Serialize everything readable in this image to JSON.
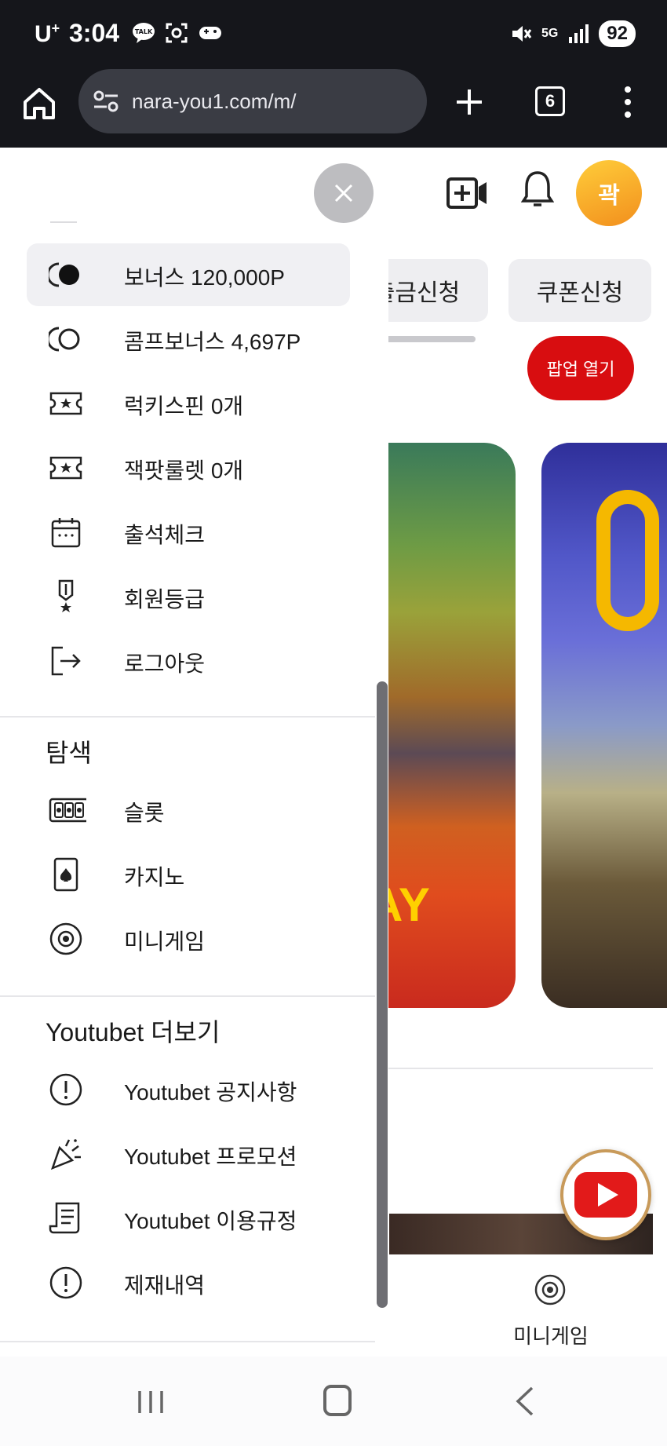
{
  "status_bar": {
    "carrier": "U",
    "carrier_sup": "+",
    "time": "3:04",
    "network": "5G",
    "battery": "92"
  },
  "browser": {
    "url": "nara-you1.com/m/",
    "tab_count": "6"
  },
  "background_page": {
    "avatar_text": "곽",
    "withdraw_label": "출금신청",
    "coupon_label": "쿠폰신청",
    "popup_button": "팝업 열기",
    "card_text": "AY",
    "bottom_nav_label": "미니게임"
  },
  "drawer": {
    "account_items": [
      {
        "label": "보너스 120,000P",
        "icon": "bonus-filled-icon",
        "active": true
      },
      {
        "label": "콤프보너스 4,697P",
        "icon": "comp-bonus-icon"
      },
      {
        "label": "럭키스핀 0개",
        "icon": "ticket-icon"
      },
      {
        "label": "잭팟룰렛 0개",
        "icon": "ticket-icon"
      },
      {
        "label": "출석체크",
        "icon": "calendar-icon"
      },
      {
        "label": "회원등급",
        "icon": "medal-icon"
      },
      {
        "label": "로그아웃",
        "icon": "logout-icon"
      }
    ],
    "explore_title": "탐색",
    "explore_items": [
      {
        "label": "슬롯",
        "icon": "slot-icon"
      },
      {
        "label": "카지노",
        "icon": "card-icon"
      },
      {
        "label": "미니게임",
        "icon": "minigame-icon"
      }
    ],
    "more_title": "Youtubet 더보기",
    "more_items": [
      {
        "label": "Youtubet 공지사항",
        "icon": "alert-icon"
      },
      {
        "label": "Youtubet 프로모션",
        "icon": "party-icon"
      },
      {
        "label": "Youtubet 이용규정",
        "icon": "document-icon"
      },
      {
        "label": "제재내역",
        "icon": "alert-icon"
      }
    ]
  },
  "colors": {
    "status_bg": "#15161b",
    "accent_red": "#d80d10",
    "avatar_orange": "#f5a623"
  }
}
